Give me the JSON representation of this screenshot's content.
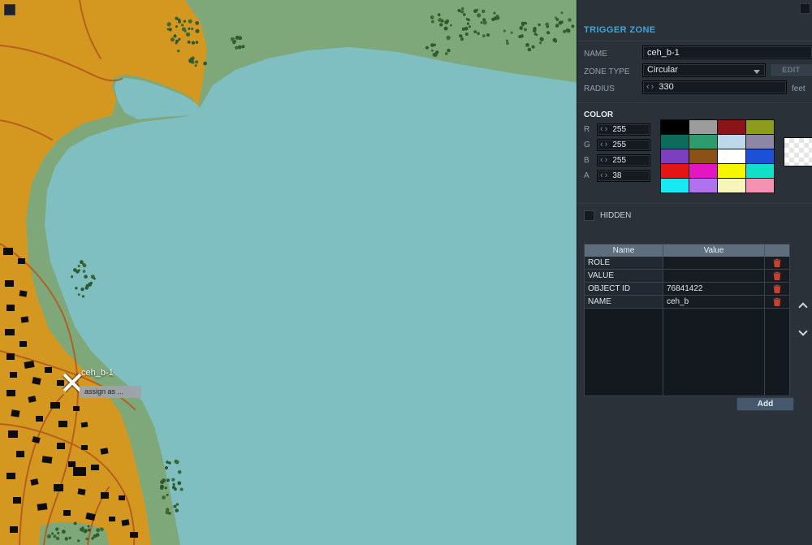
{
  "map": {
    "marker": {
      "label": "ceh_b-1",
      "tooltip": "assign as ..."
    }
  },
  "panel": {
    "title": "TRIGGER ZONE",
    "name_field": {
      "label": "NAME",
      "value": "ceh_b-1"
    },
    "zone_type": {
      "label": "ZONE TYPE",
      "value": "Circular",
      "edit_label": "EDIT"
    },
    "radius": {
      "label": "RADIUS",
      "value": "330",
      "unit": "feet"
    },
    "color": {
      "heading": "COLOR",
      "channels": [
        {
          "label": "R",
          "value": "255"
        },
        {
          "label": "G",
          "value": "255"
        },
        {
          "label": "B",
          "value": "255"
        },
        {
          "label": "A",
          "value": "38"
        }
      ],
      "palette": [
        "#000000",
        "#9c9c9c",
        "#8a1417",
        "#8e9c1e",
        "#0d6b5e",
        "#2e9b6e",
        "#bcd8ea",
        "#8e86a6",
        "#7c3fc0",
        "#8a5214",
        "#ffffff",
        "#1b51d8",
        "#e31515",
        "#e316c2",
        "#f6f600",
        "#12dfc8",
        "#19e9f2",
        "#b073ef",
        "#f6f6ba",
        "#f591b1"
      ]
    },
    "hidden": {
      "label": "HIDDEN",
      "checked": false
    },
    "attributes": {
      "headers": {
        "name": "Name",
        "value": "Value"
      },
      "rows": [
        {
          "name": "ROLE",
          "value": ""
        },
        {
          "name": "VALUE",
          "value": ""
        },
        {
          "name": "OBJECT ID",
          "value": "76841422"
        },
        {
          "name": "NAME",
          "value": "ceh_b"
        }
      ],
      "add_label": "Add"
    }
  }
}
